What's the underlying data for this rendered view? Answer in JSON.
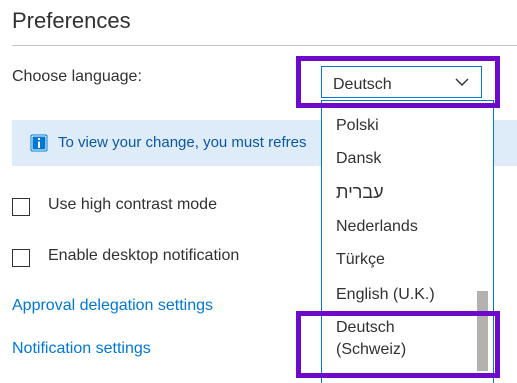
{
  "page": {
    "title": "Preferences"
  },
  "language": {
    "label": "Choose language:",
    "selected": "Deutsch",
    "options": [
      "Polski",
      "Dansk",
      "עברית",
      "Nederlands",
      "Türkçe",
      "English (U.K.)",
      "Deutsch\n(Schweiz)"
    ],
    "options_display": {
      "polski": "Polski",
      "dansk": "Dansk",
      "hebrew": "עברית",
      "nederlands": "Nederlands",
      "turkce": "Türkçe",
      "english_uk": "English (U.K.)",
      "deutsch_schweiz_line1": "Deutsch",
      "deutsch_schweiz_line2": "(Schweiz)"
    }
  },
  "info_banner": {
    "text": "To view your change, you must refres",
    "icon": "info-icon"
  },
  "settings": {
    "high_contrast": {
      "label": "Use high contrast mode",
      "checked": false
    },
    "desktop_notification": {
      "label": "Enable desktop notification",
      "checked": false
    }
  },
  "links": {
    "approval_delegation": "Approval delegation settings",
    "notification_settings": "Notification settings"
  },
  "colors": {
    "accent": "#0078d4",
    "banner_bg": "#deecf9",
    "highlight": "#6d0ac9"
  },
  "icons": {
    "chevron": "chevron-down-icon",
    "info": "info-icon"
  }
}
